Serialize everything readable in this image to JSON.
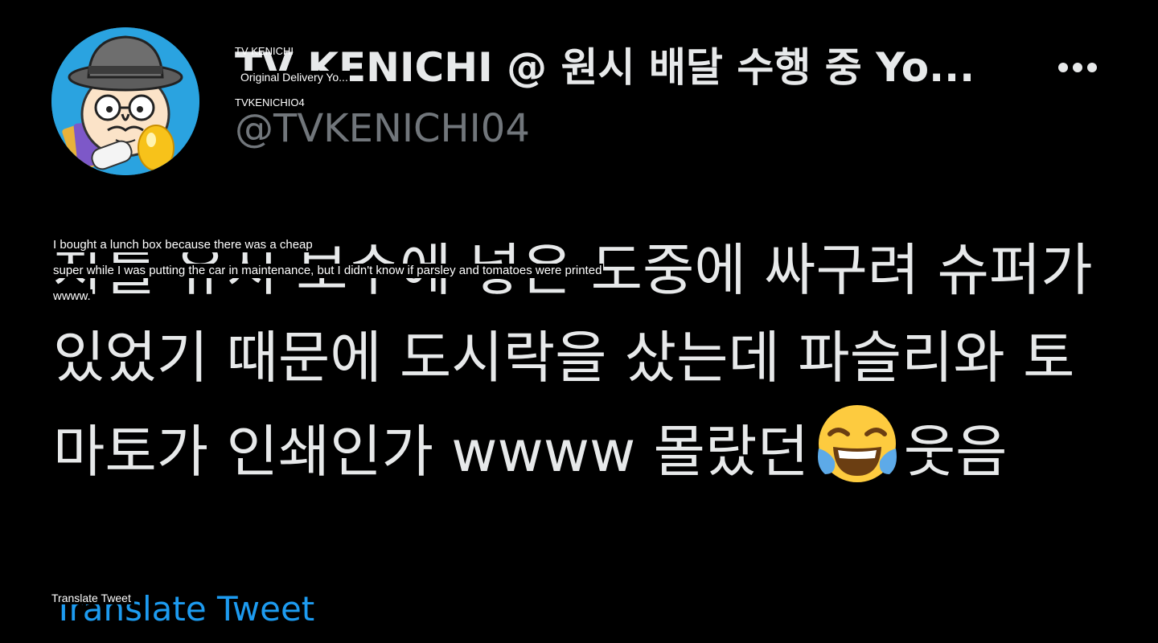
{
  "author": {
    "display_name": "TV KENICHI @ 원시 배달 수행 중 Yo...",
    "handle": "@TVKENICHI04",
    "avatar_icon": "cartoon-man-bowler-hat-avatar"
  },
  "translation_overlay": {
    "name_line_1": "TV KENICHI",
    "name_line_2": "Original Delivery Yo...",
    "handle": "TVKENICHIO4",
    "text_lines": [
      "I bought a lunch box because there was a cheap",
      "super while I was putting the car in maintenance, but I didn't know if parsley and tomatoes were printed",
      "wwww."
    ],
    "translate_label": "Translate Tweet"
  },
  "tweet": {
    "text_before_emoji": "차를 유지 보수에 넣은 도중에 싸구려 슈퍼가 있었기 때문에 도시락을 샀는데 파슬리와 토마토가 인쇄인가 wwww 몰랐던",
    "emoji_name": "face-with-tears-of-joy-icon",
    "text_after_emoji": "웃음",
    "translate_label": "Translate Tweet"
  },
  "actions": {
    "more_icon": "more-options-icon"
  },
  "colors": {
    "background": "#000000",
    "text_primary": "#e7e9ea",
    "text_secondary": "#71767b",
    "link": "#1d9bf0",
    "avatar_bg": "#2aa3e0"
  }
}
